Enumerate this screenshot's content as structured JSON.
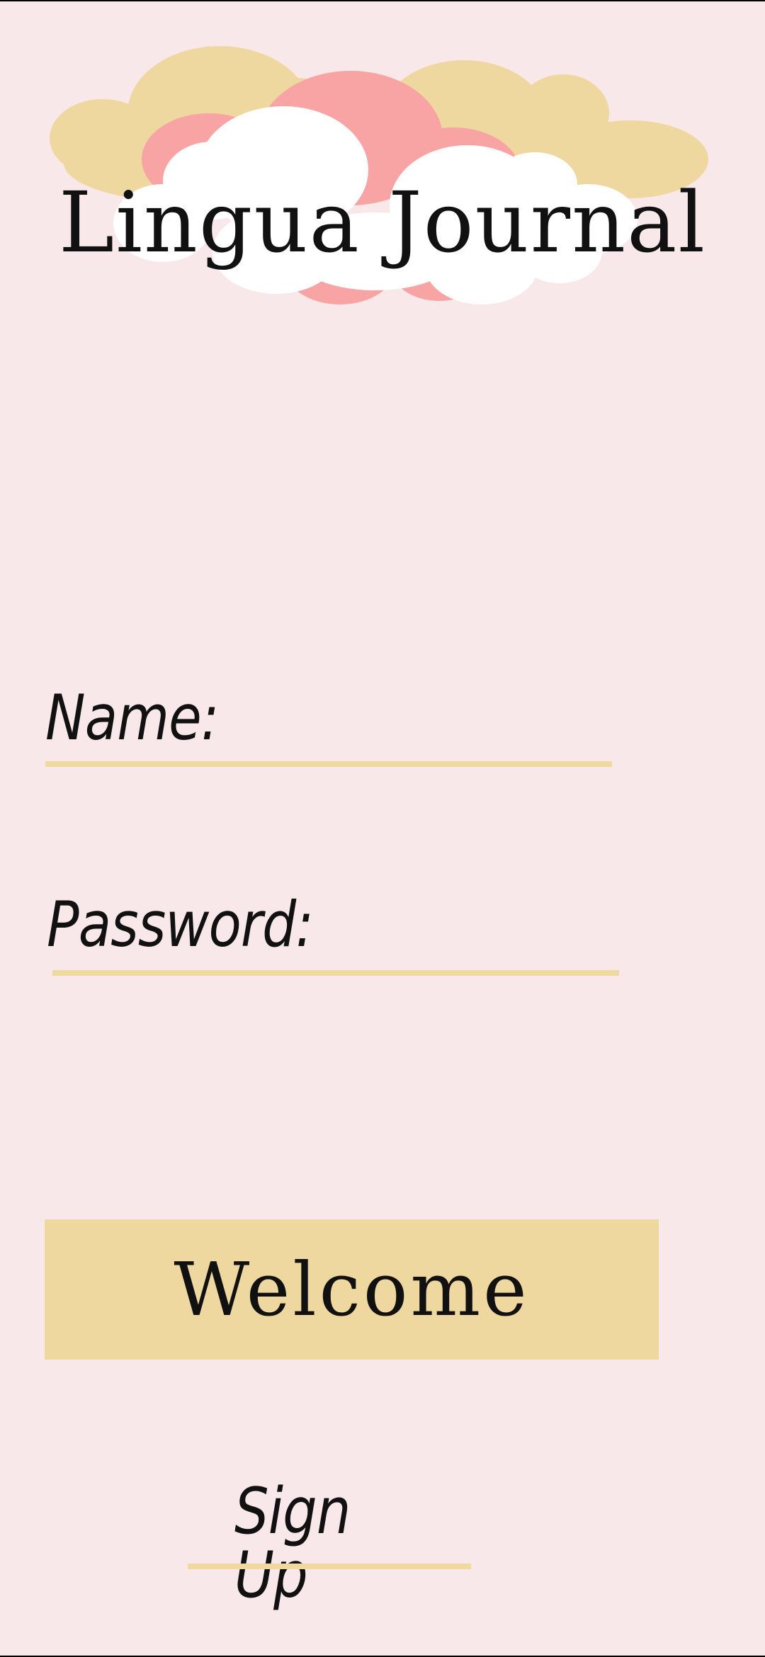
{
  "app": {
    "title": "Lingua Journal"
  },
  "login_form": {
    "name_label": "Name:",
    "name_value": "",
    "password_label": "Password:",
    "password_value": ""
  },
  "actions": {
    "welcome_label": "Welcome",
    "signup_label": "Sign Up"
  },
  "colors": {
    "background": "#f9e8ea",
    "accent_gold": "#efd8a0",
    "cloud_pink": "#f8a4a4",
    "cloud_white": "#ffffff",
    "text": "#111111"
  },
  "icons": {
    "header_illustration": "clouds-illustration"
  }
}
